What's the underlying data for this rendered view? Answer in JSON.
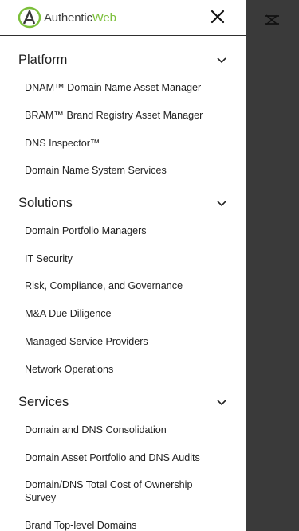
{
  "brand": {
    "logo_text_main": "Authentic",
    "logo_text_accent": "Web"
  },
  "header": {
    "close_label": "Close menu"
  },
  "sections": [
    {
      "title": "Platform",
      "items": [
        "DNAM™ Domain Name Asset Manager",
        "BRAM™ Brand Registry Asset Manager",
        "DNS Inspector™",
        "Domain Name System Services"
      ]
    },
    {
      "title": "Solutions",
      "items": [
        "Domain Portfolio Managers",
        "IT Security",
        "Risk, Compliance, and Governance",
        "M&A Due Diligence",
        "Managed Service Providers",
        "Network Operations"
      ]
    },
    {
      "title": "Services",
      "items": [
        "Domain and DNS Consolidation",
        "Domain Asset Portfolio and DNS Audits",
        "Domain/DNS Total Cost of Ownership Survey",
        "Brand Top-level Domains"
      ]
    }
  ],
  "colors": {
    "accent": "#7bbf3a",
    "overlay": "#3a3a3a"
  }
}
